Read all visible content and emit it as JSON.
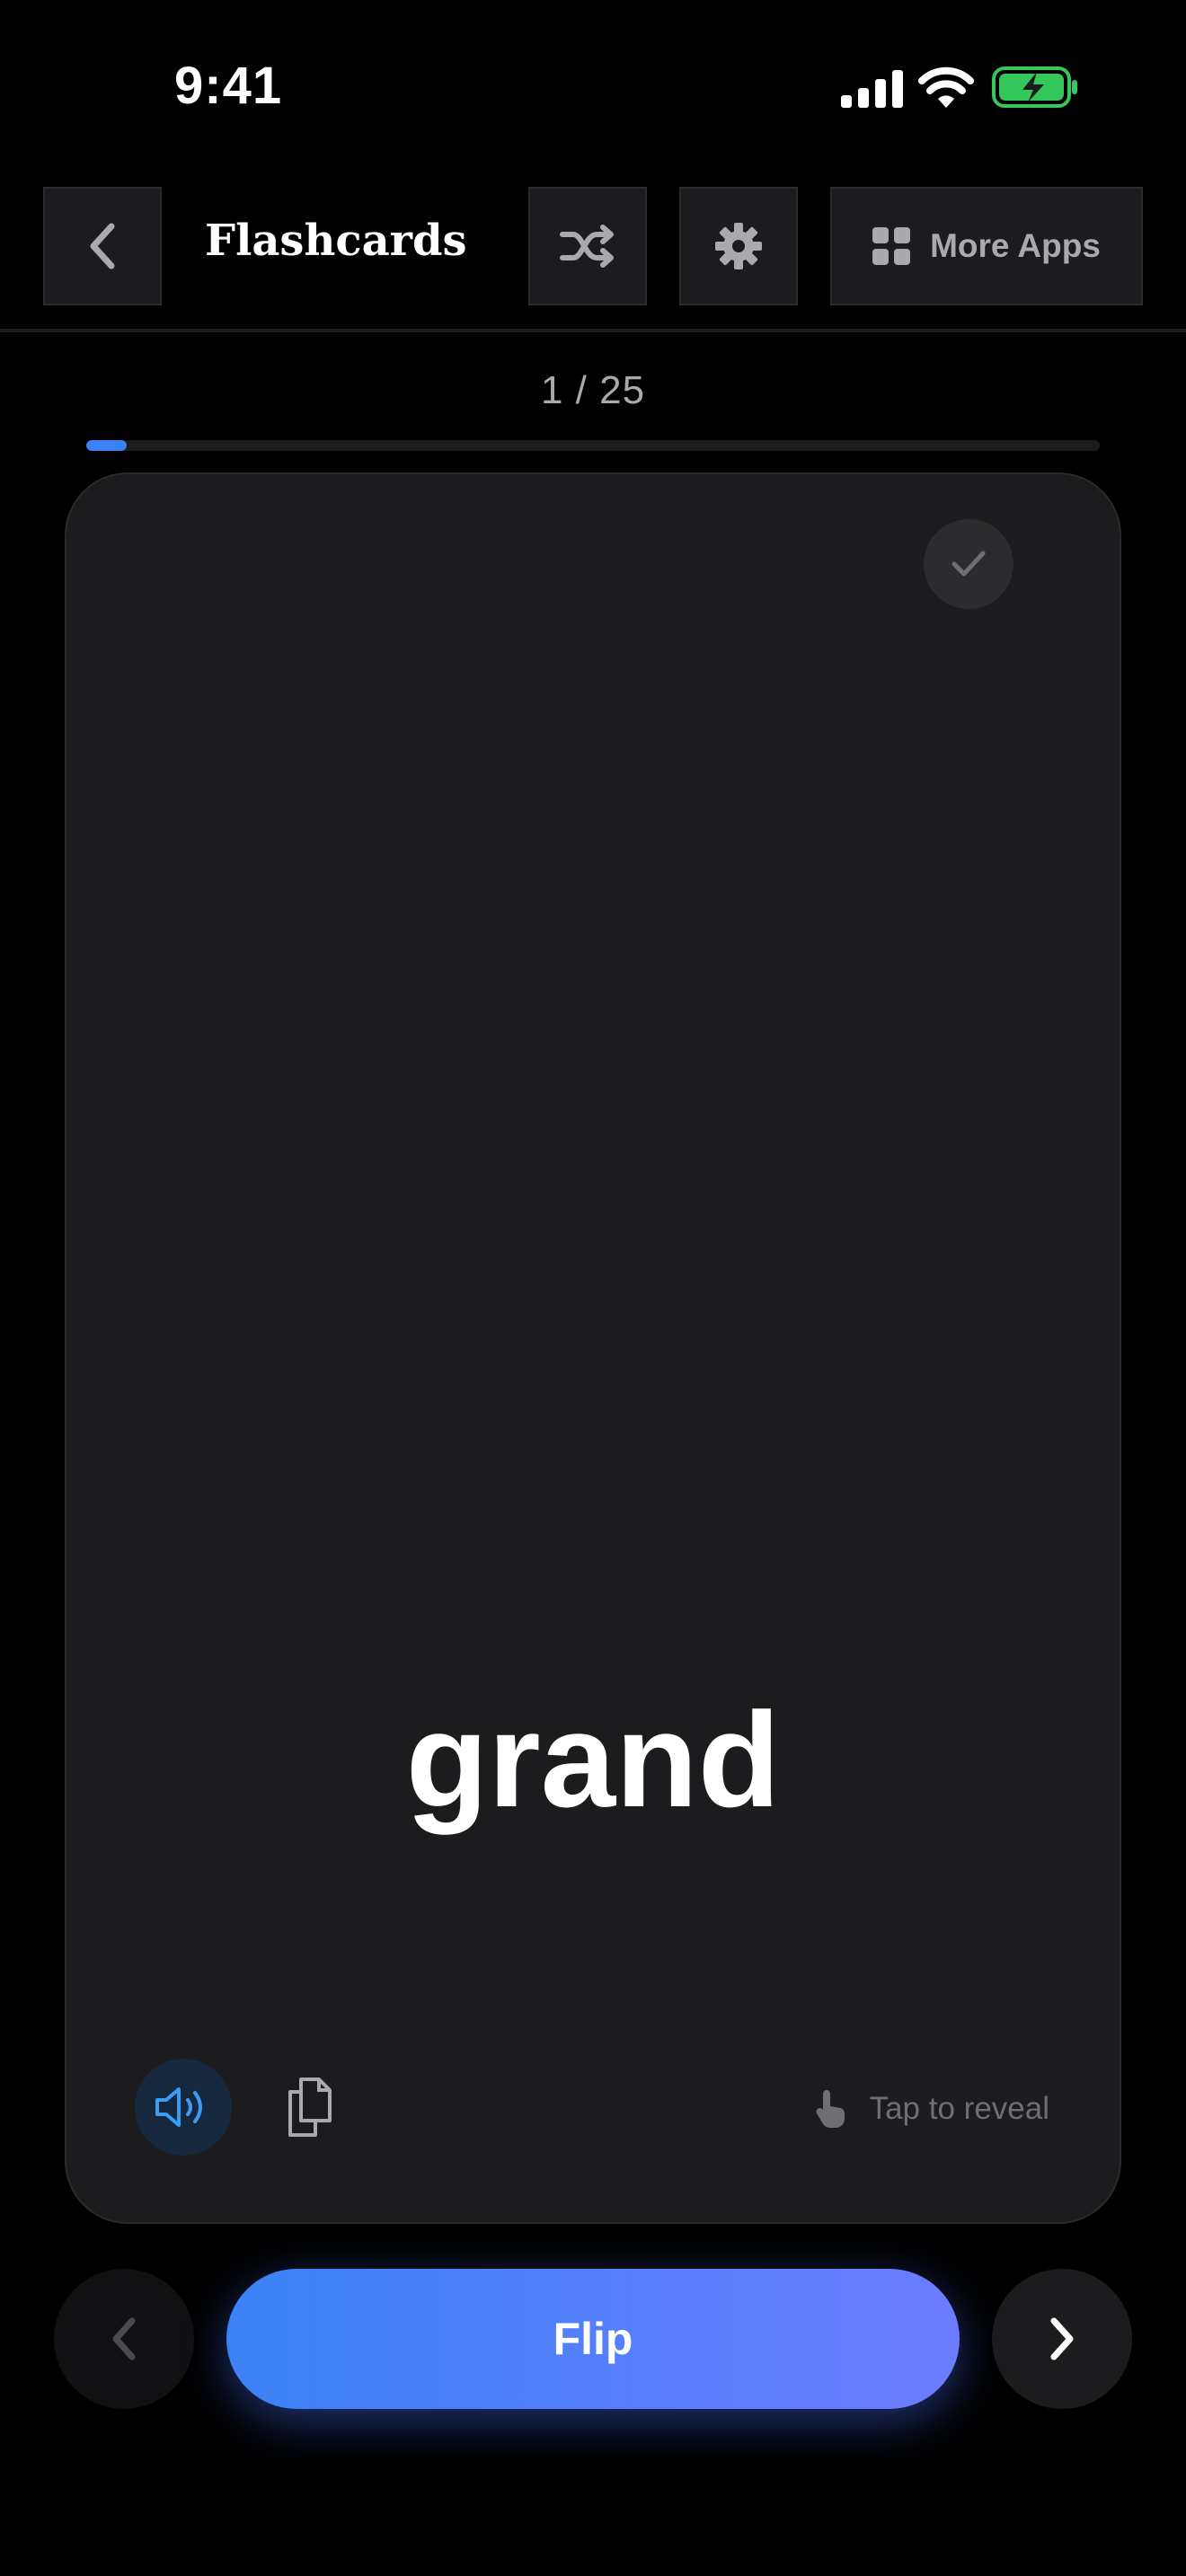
{
  "status_bar": {
    "time": "9:41",
    "icons": [
      "cellular-signal-icon",
      "wifi-icon",
      "battery-charging-icon"
    ],
    "battery_color": "#34c759"
  },
  "header": {
    "back_icon": "chevron-left-icon",
    "title": "Flashcards",
    "shuffle_icon": "shuffle-icon",
    "settings_icon": "gear-icon",
    "more_apps_icon": "grid-icon",
    "more_apps_label": "More Apps"
  },
  "progress": {
    "text": "1 / 25",
    "current": 1,
    "total": 25,
    "accent_color": "#3b82f6"
  },
  "card": {
    "word": "grand",
    "known_icon": "checkmark-icon",
    "speak_icon": "speaker-icon",
    "copy_icon": "copy-icon",
    "hint_icon": "tap-hand-icon",
    "hint_label": "Tap to reveal"
  },
  "controls": {
    "prev_icon": "chevron-left-icon",
    "flip_label": "Flip",
    "next_icon": "chevron-right-icon"
  }
}
